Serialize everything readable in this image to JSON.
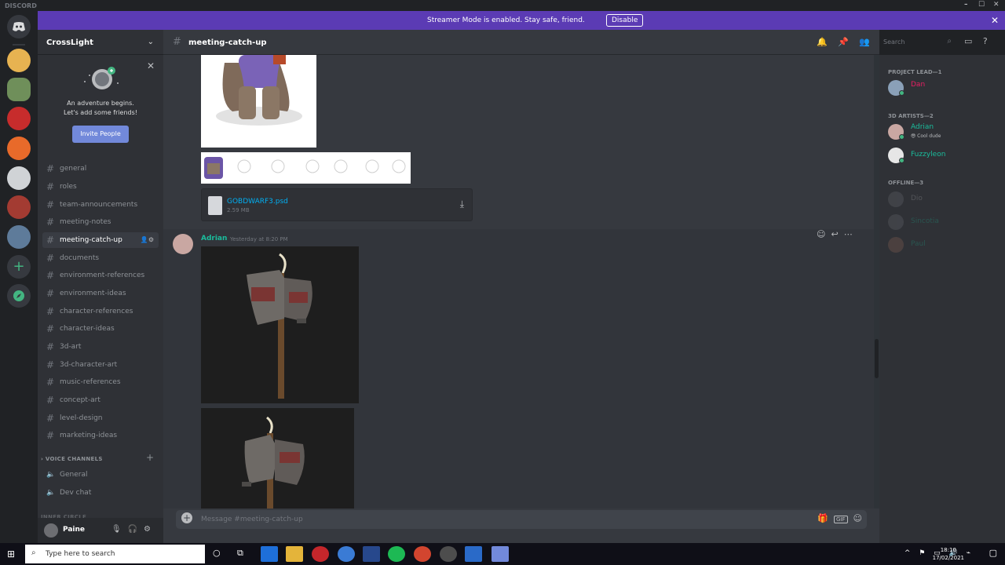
{
  "window": {
    "app_name": "DISCORD",
    "controls": [
      "–",
      "☐",
      "✕"
    ]
  },
  "banner": {
    "message": "Streamer Mode is enabled. Stay safe, friend.",
    "disable_label": "Disable",
    "close": "✕"
  },
  "server": {
    "name": "CrossLight",
    "invite": {
      "line1": "An adventure begins.",
      "line2": "Let's add some friends!",
      "button": "Invite People"
    },
    "text_channels": [
      {
        "name": "general"
      },
      {
        "name": "roles"
      },
      {
        "name": "team-announcements"
      },
      {
        "name": "meeting-notes"
      },
      {
        "name": "meeting-catch-up",
        "active": true
      },
      {
        "name": "documents"
      },
      {
        "name": "environment-references"
      },
      {
        "name": "environment-ideas"
      },
      {
        "name": "character-references"
      },
      {
        "name": "character-ideas"
      },
      {
        "name": "3d-art"
      },
      {
        "name": "3d-character-art"
      },
      {
        "name": "music-references"
      },
      {
        "name": "concept-art"
      },
      {
        "name": "level-design"
      },
      {
        "name": "marketing-ideas"
      }
    ],
    "voice_category": "VOICE CHANNELS",
    "voice_channels": [
      {
        "name": "General"
      },
      {
        "name": "Dev chat"
      }
    ],
    "next_category": "INNER CIRCLE"
  },
  "user": {
    "name": "Paine"
  },
  "channel": {
    "name": "meeting-catch-up"
  },
  "search": {
    "placeholder": "Search"
  },
  "messages": {
    "file": {
      "name": "GOBDWARF3.psd",
      "size": "2.59 MB"
    },
    "author": "Adrian",
    "timestamp": "Yesterday at 8:20 PM"
  },
  "composer": {
    "placeholder": "Message #meeting-catch-up",
    "gif": "GIF"
  },
  "members": {
    "groups": [
      {
        "title": "PROJECT LEAD—1",
        "members": [
          {
            "name": "Dan",
            "color": "#e91e63"
          }
        ]
      },
      {
        "title": "3D ARTISTS—2",
        "members": [
          {
            "name": "Adrian",
            "color": "#1abc9c",
            "status": "😎 Cool dude"
          },
          {
            "name": "Fuzzyleon",
            "color": "#1abc9c"
          }
        ]
      },
      {
        "title": "OFFLINE—3",
        "members": [
          {
            "name": "Dio"
          },
          {
            "name": "Sincotia"
          },
          {
            "name": "Paul"
          }
        ]
      }
    ]
  },
  "taskbar": {
    "search_placeholder": "Type here to search",
    "time": "18:10",
    "date": "17/02/2021"
  },
  "colors": {
    "blurple": "#7289da",
    "banner": "#5b3bb4",
    "teal": "#1abc9c",
    "red": "#e91e63"
  }
}
